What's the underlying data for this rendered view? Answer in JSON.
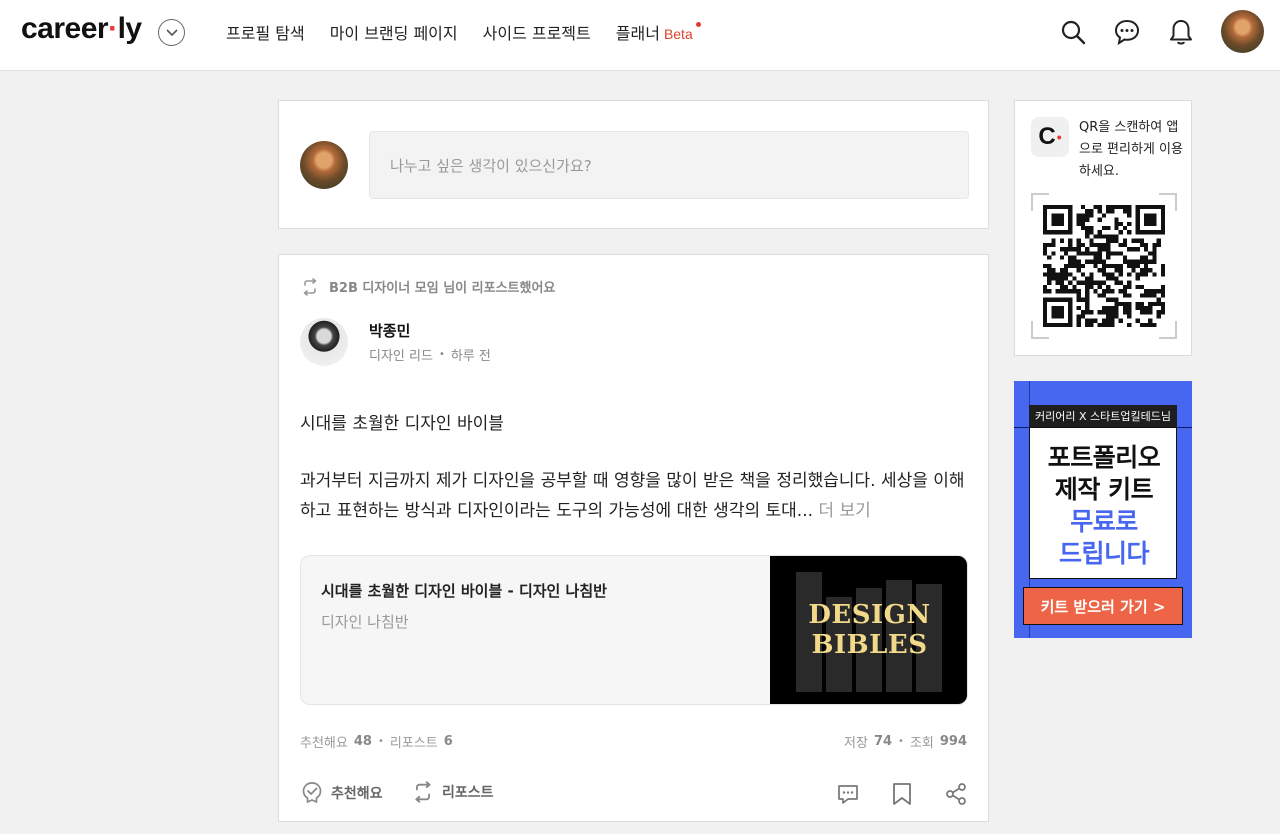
{
  "header": {
    "logo_text": "career",
    "logo_dot": "·",
    "logo_tail": "ly",
    "nav": [
      {
        "label": "프로필 탐색"
      },
      {
        "label": "마이 브랜딩 페이지"
      },
      {
        "label": "사이드 프로젝트"
      },
      {
        "label": "플래너",
        "badge": "Beta"
      }
    ],
    "icons": [
      "search-icon",
      "chat-icon",
      "bell-icon",
      "avatar"
    ]
  },
  "composer": {
    "placeholder": "나누고 싶은 생각이 있으신가요?"
  },
  "post": {
    "repost_notice": "B2B 디자이너 모임 님이 리포스트했어요",
    "author": {
      "name": "박종민",
      "role": "디자인 리드",
      "time": "하루 전"
    },
    "title": "시대를 초월한 디자인 바이블",
    "body": "과거부터 지금까지 제가 디자인을 공부할 때 영향을 많이 받은 책을 정리했습니다. 세상을 이해하고 표현하는 방식과 디자인이라는 도구의 가능성에 대한 생각의 토대...",
    "more_label": "더 보기",
    "link": {
      "title": "시대를 초월한 디자인 바이블 - 디자인 나침반",
      "source": "디자인 나침반",
      "thumb_line1": "DESIGN",
      "thumb_line2": "BIBLES"
    },
    "stats": {
      "like_label": "추천해요",
      "like_count": "48",
      "repost_label": "리포스트",
      "repost_count": "6",
      "save_label": "저장",
      "save_count": "74",
      "view_label": "조회",
      "view_count": "994"
    },
    "actions": {
      "like": "추천해요",
      "repost": "리포스트"
    }
  },
  "sidebar": {
    "qr": {
      "app_letter": "C",
      "text": "QR을 스캔하여 앱으로 편리하게 이용하세요."
    },
    "ad": {
      "top_label": "커리어리 X 스타트업킬테드님",
      "line1": "포트폴리오",
      "line2": "제작 키트",
      "line3": "무료로",
      "line4": "드립니다",
      "cta": "키트 받으러 가기 >",
      "accent": "#4867f0",
      "cta_color": "#ee6446"
    }
  }
}
